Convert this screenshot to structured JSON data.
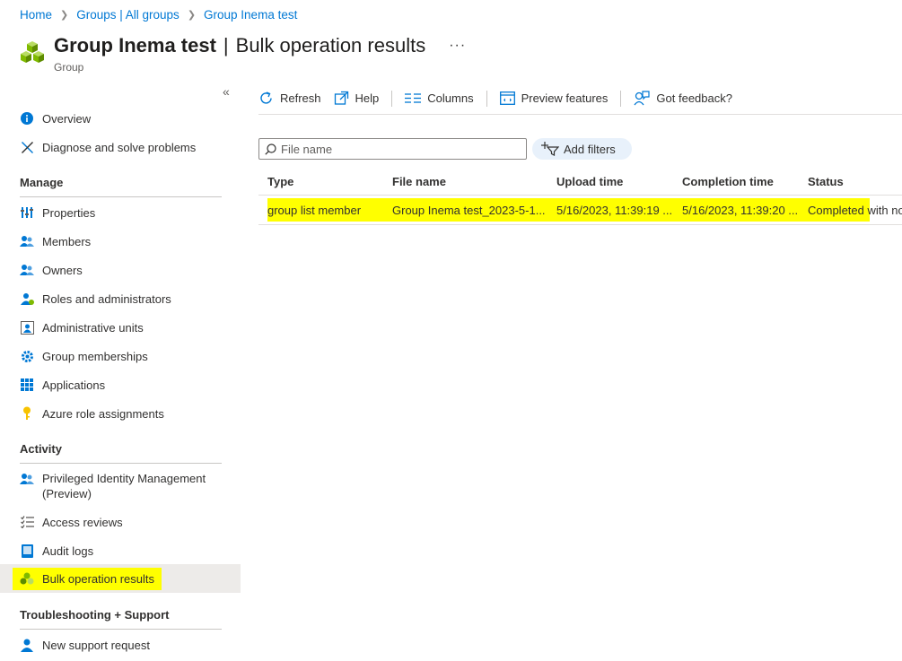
{
  "breadcrumb": {
    "home": "Home",
    "groups": "Groups | All groups",
    "current": "Group Inema test"
  },
  "header": {
    "name": "Group Inema test",
    "divider": "|",
    "subtitle": "Bulk operation results",
    "more": "···",
    "type": "Group"
  },
  "sidebar": {
    "collapse": "«",
    "top_items": [
      {
        "label": "Overview",
        "icon": "info-icon"
      },
      {
        "label": "Diagnose and solve problems",
        "icon": "wrench-icon"
      }
    ],
    "sections": {
      "manage": "Manage",
      "activity": "Activity",
      "support": "Troubleshooting + Support"
    },
    "manage_items": [
      {
        "label": "Properties",
        "icon": "properties-icon"
      },
      {
        "label": "Members",
        "icon": "members-icon"
      },
      {
        "label": "Owners",
        "icon": "owners-icon"
      },
      {
        "label": "Roles and administrators",
        "icon": "roles-icon"
      },
      {
        "label": "Administrative units",
        "icon": "admin-units-icon"
      },
      {
        "label": "Group memberships",
        "icon": "gear-icon"
      },
      {
        "label": "Applications",
        "icon": "grid-icon"
      },
      {
        "label": "Azure role assignments",
        "icon": "key-icon"
      }
    ],
    "activity_items": [
      {
        "label": "Privileged Identity Management",
        "label2": "(Preview)",
        "icon": "pim-icon"
      },
      {
        "label": "Access reviews",
        "icon": "checklist-icon"
      },
      {
        "label": "Audit logs",
        "icon": "log-icon"
      },
      {
        "label": "Bulk operation results",
        "icon": "bulk-icon"
      }
    ],
    "support_items": [
      {
        "label": "New support request",
        "icon": "support-icon"
      }
    ]
  },
  "toolbar": {
    "refresh": "Refresh",
    "help": "Help",
    "columns": "Columns",
    "preview": "Preview features",
    "feedback": "Got feedback?"
  },
  "search": {
    "placeholder": "File name",
    "filters": "Add filters"
  },
  "table": {
    "columns": [
      "Type",
      "File name",
      "Upload time",
      "Completion time",
      "Status"
    ],
    "rows": [
      {
        "type": "group list member",
        "file_name": "Group Inema test_2023-5-1...",
        "upload_time": "5/16/2023, 11:39:19 ...",
        "completion_time": "5/16/2023, 11:39:20 ...",
        "status": "Completed with no"
      }
    ]
  },
  "colors": {
    "accent": "#0078d4",
    "highlight": "#ffff00",
    "selected_bg": "#edebe9",
    "group_green": "#7fba00"
  }
}
